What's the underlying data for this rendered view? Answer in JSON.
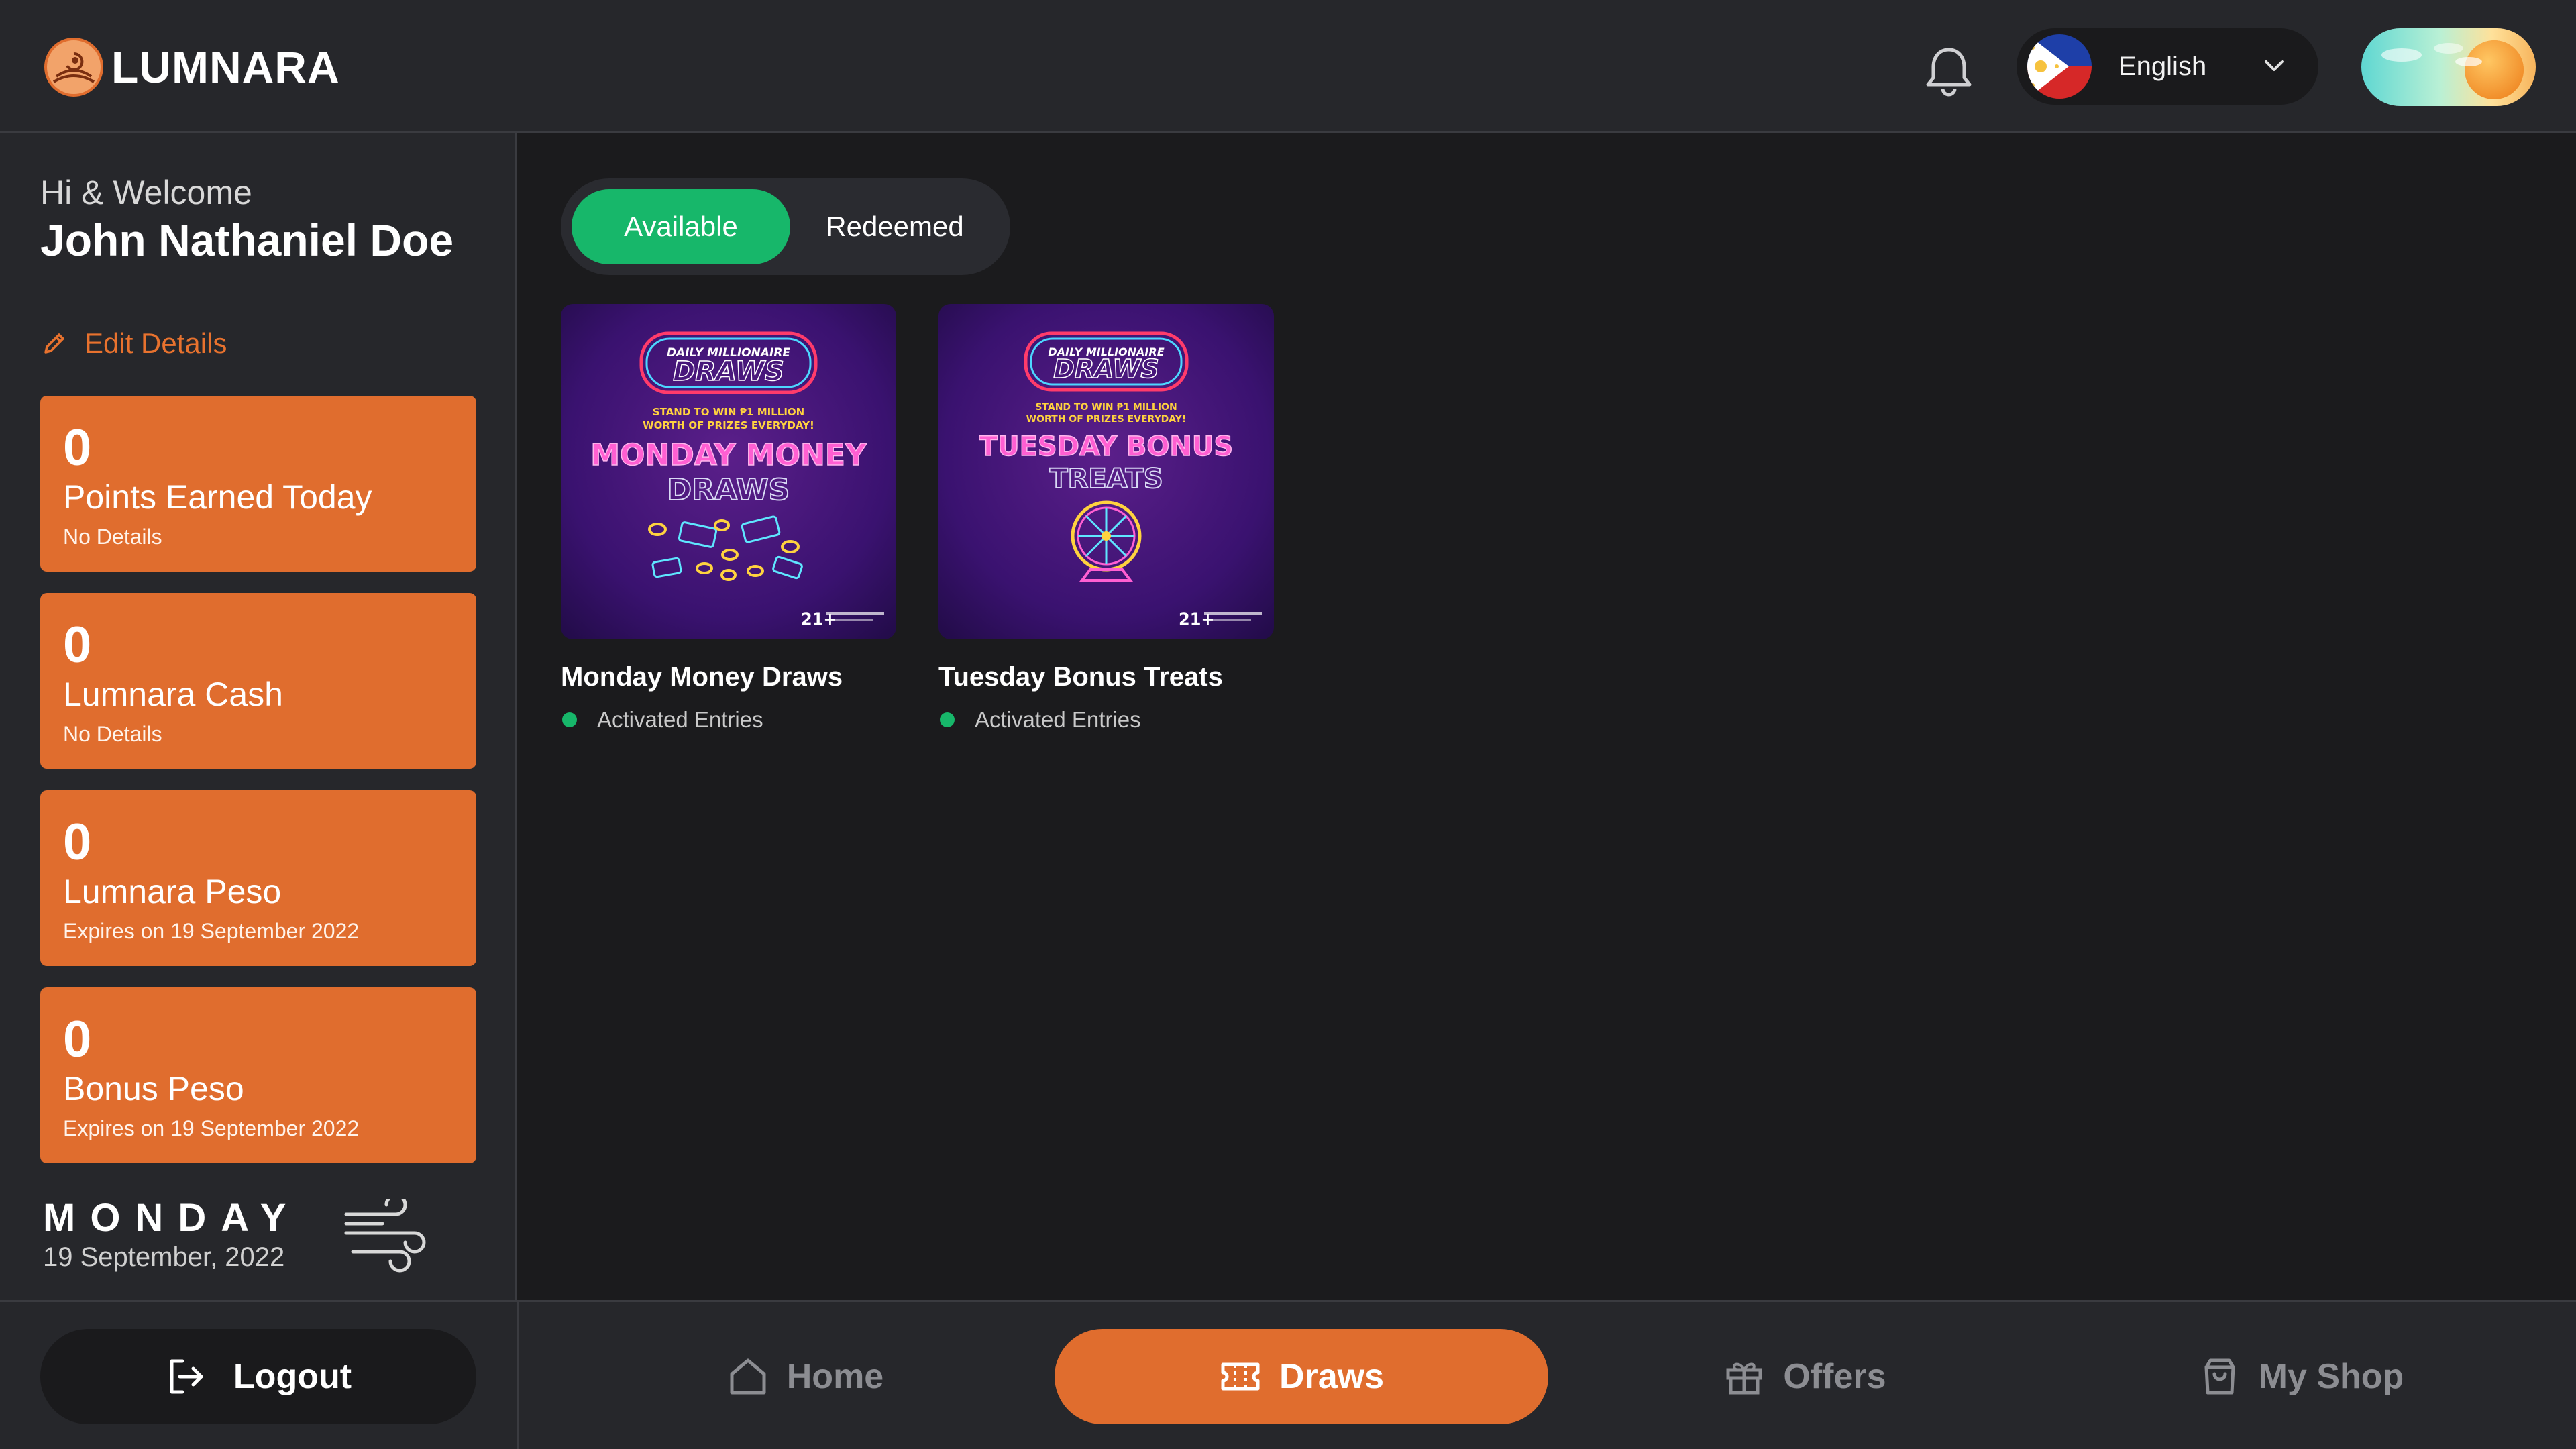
{
  "header": {
    "brand": "LUMNARA",
    "language": {
      "selected": "English"
    }
  },
  "sidebar": {
    "greeting": "Hi & Welcome",
    "user_name": "John Nathaniel Doe",
    "edit_label": "Edit Details",
    "stats": [
      {
        "value": "0",
        "title": "Points Earned Today",
        "subtitle": "No Details"
      },
      {
        "value": "0",
        "title": "Lumnara Cash",
        "subtitle": "No Details"
      },
      {
        "value": "0",
        "title": "Lumnara Peso",
        "subtitle": "Expires on 19 September 2022"
      },
      {
        "value": "0",
        "title": "Bonus Peso",
        "subtitle": "Expires on 19 September 2022"
      }
    ],
    "day": "MONDAY",
    "date": "19 September, 2022",
    "weather_icon": "wind-icon"
  },
  "tabs": {
    "available": "Available",
    "redeemed": "Redeemed",
    "active": "available"
  },
  "draws": [
    {
      "title": "Monday Money Draws",
      "status": "Activated Entries",
      "image": {
        "badge_top": "DAILY MILLIONAIRE",
        "badge_main": "DRAWS",
        "tagline_1": "STAND TO WIN ₱1 MILLION",
        "tagline_2": "WORTH OF PRIZES EVERYDAY!",
        "headline_1": "MONDAY MONEY",
        "headline_2": "DRAWS",
        "corner": "21+"
      }
    },
    {
      "title": "Tuesday Bonus Treats",
      "status": "Activated Entries",
      "image": {
        "badge_top": "DAILY MILLIONAIRE",
        "badge_main": "DRAWS",
        "tagline_1": "STAND TO WIN ₱1 MILLION",
        "tagline_2": "WORTH OF PRIZES EVERYDAY!",
        "headline_1": "TUESDAY BONUS",
        "headline_2": "TREATS",
        "corner": "21+"
      }
    }
  ],
  "bottom_nav": {
    "logout": "Logout",
    "items": [
      {
        "label": "Home",
        "icon": "home-icon"
      },
      {
        "label": "Draws",
        "icon": "ticket-icon"
      },
      {
        "label": "Offers",
        "icon": "gift-icon"
      },
      {
        "label": "My Shop",
        "icon": "shopping-bag-icon"
      }
    ],
    "active": "Draws"
  },
  "colors": {
    "accent_orange": "#e06d2e",
    "accent_green": "#17b76a",
    "panel": "#26272b",
    "background": "#1b1b1d"
  }
}
